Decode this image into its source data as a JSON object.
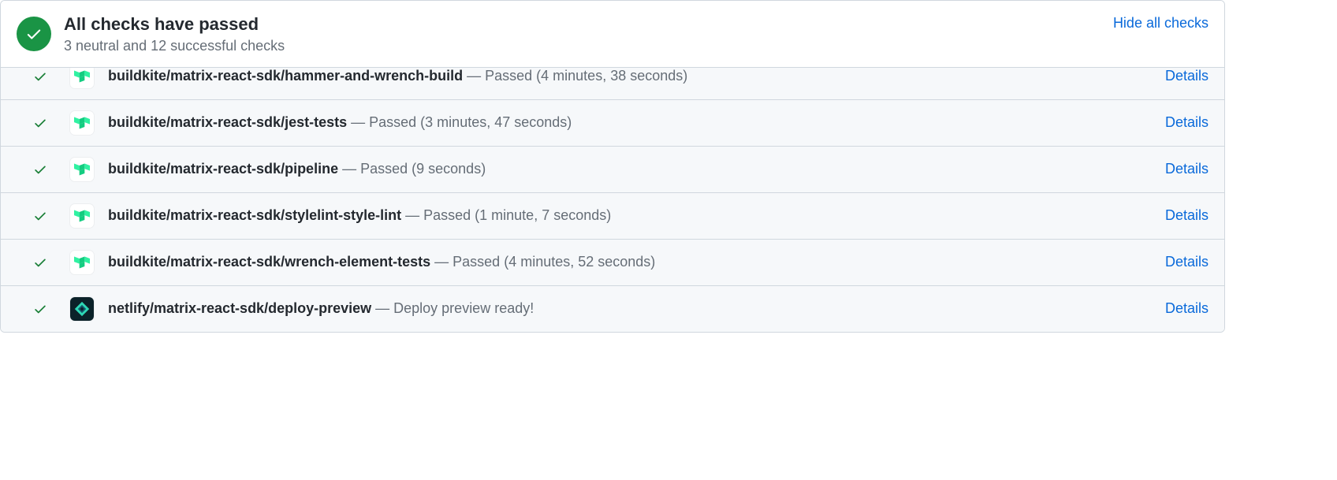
{
  "header": {
    "title": "All checks have passed",
    "subtitle": "3 neutral and 12 successful checks",
    "hide_link": "Hide all checks"
  },
  "details_label": "Details",
  "checks": [
    {
      "name": "buildkite/matrix-react-sdk/hammer-and-wrench-build",
      "status": "Passed (4 minutes, 38 seconds)",
      "provider": "buildkite"
    },
    {
      "name": "buildkite/matrix-react-sdk/jest-tests",
      "status": "Passed (3 minutes, 47 seconds)",
      "provider": "buildkite"
    },
    {
      "name": "buildkite/matrix-react-sdk/pipeline",
      "status": "Passed (9 seconds)",
      "provider": "buildkite"
    },
    {
      "name": "buildkite/matrix-react-sdk/stylelint-style-lint",
      "status": "Passed (1 minute, 7 seconds)",
      "provider": "buildkite"
    },
    {
      "name": "buildkite/matrix-react-sdk/wrench-element-tests",
      "status": "Passed (4 minutes, 52 seconds)",
      "provider": "buildkite"
    },
    {
      "name": "netlify/matrix-react-sdk/deploy-preview",
      "status": "Deploy preview ready!",
      "provider": "netlify"
    }
  ]
}
